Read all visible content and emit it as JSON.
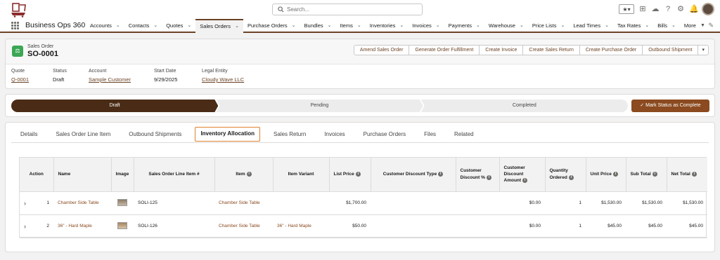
{
  "colors": {
    "brand": "#6b4325",
    "accent_button": "#8b4a1f",
    "active_tab_border": "#e0812e",
    "path_current": "#4a2c16",
    "object_icon": "#3ba755"
  },
  "topbar": {
    "search_placeholder": "Search...",
    "icons": [
      "favorites-star-icon",
      "add-icon",
      "trailhead-icon",
      "help-icon",
      "setup-gear-icon",
      "notifications-bell-icon",
      "user-avatar"
    ]
  },
  "nav": {
    "app_name": "Business Ops 360",
    "items": [
      {
        "label": "Accounts"
      },
      {
        "label": "Contacts"
      },
      {
        "label": "Quotes"
      },
      {
        "label": "Sales Orders",
        "active": true
      },
      {
        "label": "Purchase Orders"
      },
      {
        "label": "Bundles"
      },
      {
        "label": "Items"
      },
      {
        "label": "Inventories"
      },
      {
        "label": "Invoices"
      },
      {
        "label": "Payments"
      },
      {
        "label": "Warehouse"
      },
      {
        "label": "Price Lists"
      },
      {
        "label": "Lead Times"
      },
      {
        "label": "Tax Rates"
      },
      {
        "label": "Bills"
      },
      {
        "label": "More"
      }
    ]
  },
  "record": {
    "object_type": "Sales Order",
    "title": "SO-0001",
    "actions": [
      "Amend Sales Order",
      "Generate Order Fulfillment",
      "Create Invoice",
      "Create Sales Return",
      "Create Purchase Order",
      "Outbound Shipment"
    ],
    "fields": {
      "quote": {
        "label": "Quote",
        "value": "Q-0001"
      },
      "status": {
        "label": "Status",
        "value": "Draft"
      },
      "account": {
        "label": "Account",
        "value": "Sample Customer"
      },
      "start_date": {
        "label": "Start Date",
        "value": "9/29/2025"
      },
      "legal_entity": {
        "label": "Legal Entity",
        "value": "Cloudy Wave LLC"
      }
    }
  },
  "path": {
    "steps": [
      "Draft",
      "Pending",
      "Completed"
    ],
    "current": "Draft",
    "mark_button": "Mark Status as Complete"
  },
  "tabs": [
    {
      "label": "Details"
    },
    {
      "label": "Sales Order Line Item"
    },
    {
      "label": "Outbound Shipments"
    },
    {
      "label": "Inventory Allocation",
      "active": true
    },
    {
      "label": "Sales Return"
    },
    {
      "label": "Invoices"
    },
    {
      "label": "Purchase Orders"
    },
    {
      "label": "Files"
    },
    {
      "label": "Related"
    }
  ],
  "table": {
    "headers": [
      "Action",
      "Name",
      "Image",
      "Sales Order Line Item #",
      "Item",
      "Item Variant",
      "List Price",
      "Customer Discount Type",
      "Customer Discount %",
      "Customer Discount Amount",
      "Quantity Ordered",
      "Unit Price",
      "Sub Total",
      "Net Total"
    ],
    "rows": [
      {
        "index": "1",
        "name": "Chamber Side Table",
        "line_item": "SOLI-125",
        "item": "Chamber Side Table",
        "variant": "",
        "list_price": "$1,700.00",
        "discount_type": "",
        "discount_pct": "",
        "discount_amount": "$0.00",
        "qty": "1",
        "unit_price": "$1,530.00",
        "sub_total": "$1,530.00",
        "net_total": "$1,530.00"
      },
      {
        "index": "2",
        "name": "36\" - Hard Maple",
        "line_item": "SOLI-126",
        "item": "Chamber Side Table",
        "variant": "36\" - Hard Maple",
        "list_price": "$50.00",
        "discount_type": "",
        "discount_pct": "",
        "discount_amount": "$0.00",
        "qty": "1",
        "unit_price": "$45.00",
        "sub_total": "$45.00",
        "net_total": "$45.00"
      }
    ]
  }
}
